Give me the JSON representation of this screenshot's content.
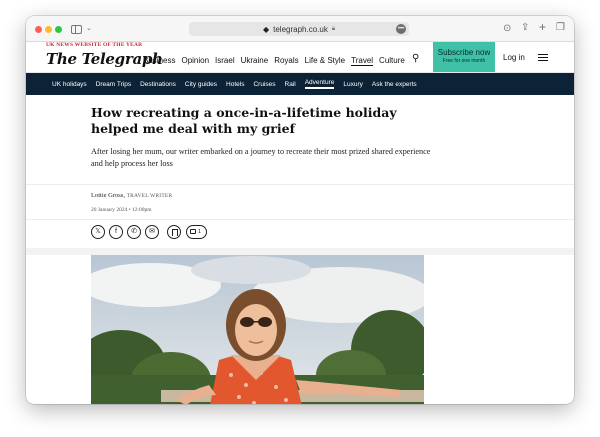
{
  "browser": {
    "url": "telegraph.co.uk",
    "lock_icon": "lock-icon",
    "more_icon": "ellipsis-icon"
  },
  "masthead": {
    "tagline": "UK NEWS WEBSITE OF THE YEAR",
    "logo": "The Telegraph",
    "nav": [
      "Business",
      "Opinion",
      "Israel",
      "Ukraine",
      "Royals",
      "Life & Style",
      "Travel",
      "Culture"
    ],
    "active_nav": "Travel",
    "subscribe_label": "Subscribe now",
    "subscribe_sub": "Free for one month",
    "login_label": "Log in"
  },
  "section_nav": {
    "items": [
      "UK holidays",
      "Dream Trips",
      "Destinations",
      "City guides",
      "Hotels",
      "Cruises",
      "Rail",
      "Adventure",
      "Luxury",
      "Ask the experts"
    ],
    "active": "Adventure"
  },
  "article": {
    "headline": "How recreating a once-in-a-lifetime holiday helped me deal with my grief",
    "standfirst": "After losing her mum, our writer embarked on a journey to recreate their most prized shared experience and help process her loss",
    "author": "Lottie Gross,",
    "author_role": "TRAVEL WRITER",
    "date": "20 January 2024 • 12:00pm",
    "comment_count": "1"
  },
  "colors": {
    "accent": "#3ec1a7",
    "nav_bg": "#0c2236",
    "tagline": "#c1282d"
  }
}
